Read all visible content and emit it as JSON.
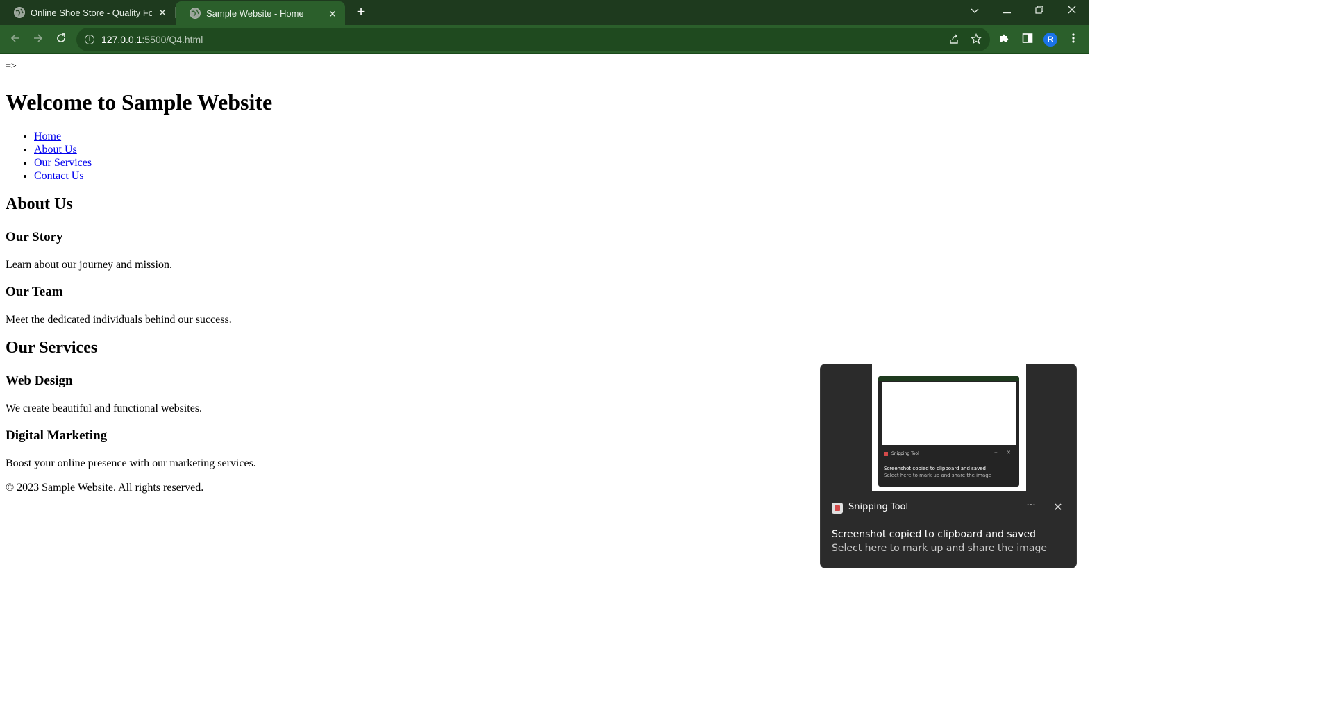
{
  "browser": {
    "tabs": [
      {
        "title": "Online Shoe Store - Quality Foot",
        "active": false
      },
      {
        "title": "Sample Website - Home",
        "active": true
      }
    ],
    "address": {
      "host": "127.0.0.1",
      "rest": ":5500/Q4.html"
    },
    "profile_initial": "R",
    "colors": {
      "tabstrip": "#1e3a1e",
      "toolbar": "#2b5f2b",
      "omnibox": "#1f4a1f"
    }
  },
  "page": {
    "top_text": "=>",
    "heading": "Welcome to Sample Website",
    "nav": [
      "Home",
      "About Us",
      "Our Services",
      "Contact Us"
    ],
    "about": {
      "title": "About Us",
      "story_title": "Our Story",
      "story_text": "Learn about our journey and mission.",
      "team_title": "Our Team",
      "team_text": "Meet the dedicated individuals behind our success."
    },
    "services": {
      "title": "Our Services",
      "web_title": "Web Design",
      "web_text": "We create beautiful and functional websites.",
      "marketing_title": "Digital Marketing",
      "marketing_text": "Boost your online presence with our marketing services."
    },
    "footer": "© 2023 Sample Website. All rights reserved."
  },
  "toast": {
    "app_name": "Snipping Tool",
    "message": "Screenshot copied to clipboard and saved",
    "subtext": "Select here to mark up and share the image",
    "more_label": "···",
    "close_label": "✕"
  }
}
